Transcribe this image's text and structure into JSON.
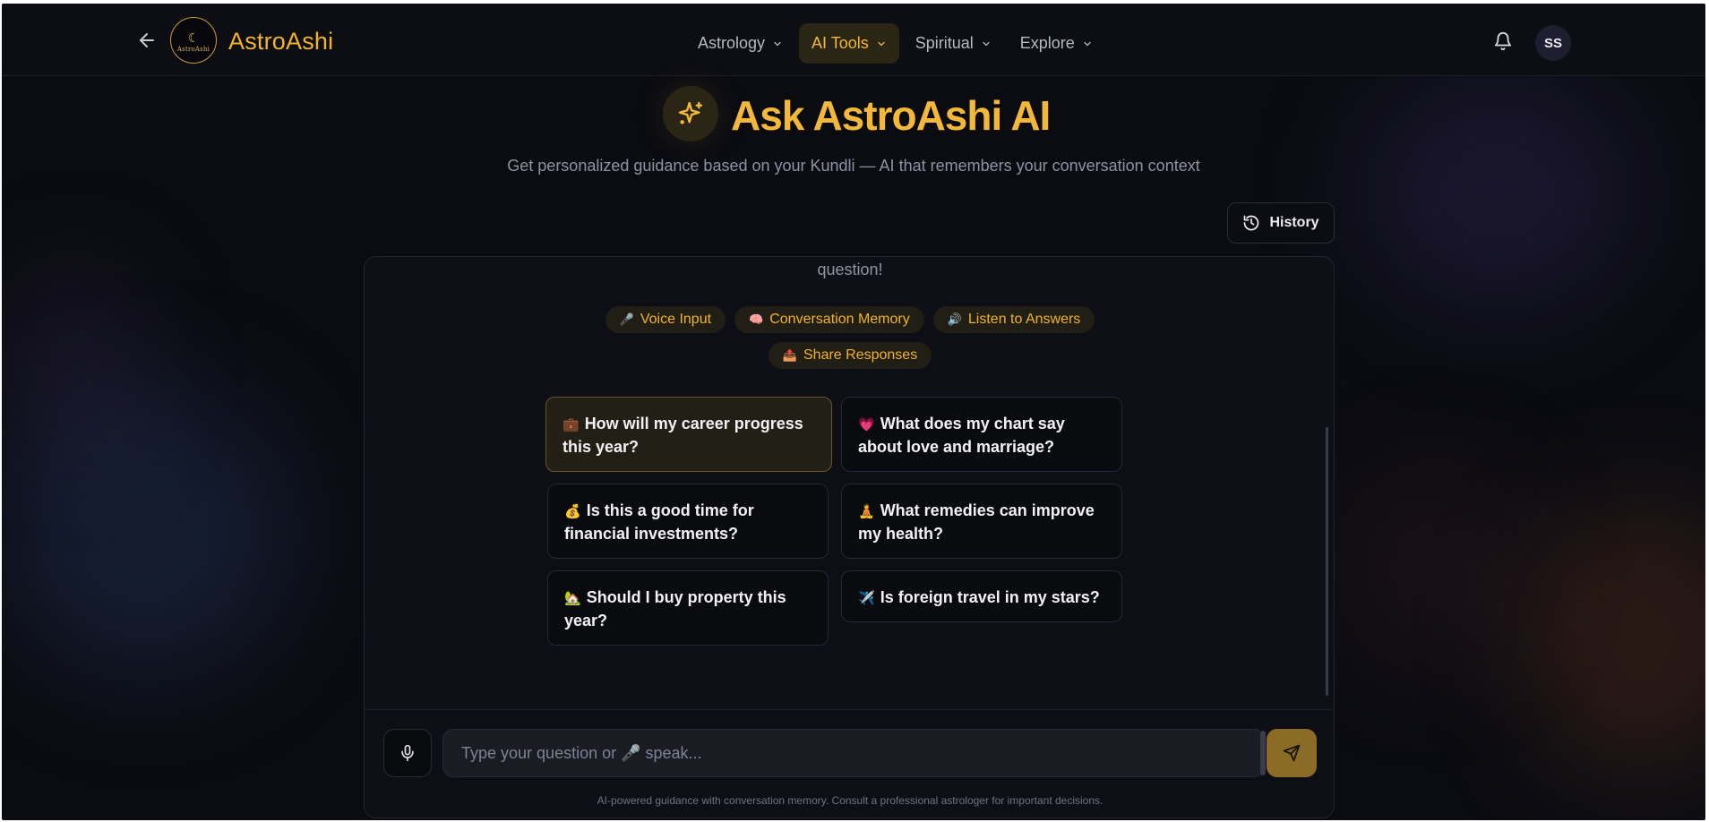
{
  "header": {
    "brand": "AstroAshi",
    "logo_text": "AstroAshi",
    "nav": [
      {
        "label": "Astrology",
        "active": false
      },
      {
        "label": "AI Tools",
        "active": true
      },
      {
        "label": "Spiritual",
        "active": false
      },
      {
        "label": "Explore",
        "active": false
      }
    ],
    "avatar_initials": "SS",
    "icons": {
      "back": "arrow-left-icon",
      "notifications": "bell-icon"
    }
  },
  "hero": {
    "icon": "sparkles-icon",
    "title": "Ask AstroAshi AI",
    "subtitle": "Get personalized guidance based on your Kundli — AI that remembers your conversation context"
  },
  "history_button": {
    "label": "History",
    "icon": "history-icon"
  },
  "chat": {
    "intro_tail": "question!",
    "features": [
      {
        "emoji": "🎤",
        "label": "Voice Input"
      },
      {
        "emoji": "🧠",
        "label": "Conversation Memory"
      },
      {
        "emoji": "🔊",
        "label": "Listen to Answers"
      },
      {
        "emoji": "📤",
        "label": "Share Responses"
      }
    ],
    "suggestions": [
      {
        "emoji": "💼",
        "text": "How will my career progress this year?",
        "active": true
      },
      {
        "emoji": "💗",
        "text": "What does my chart say about love and marriage?",
        "active": false
      },
      {
        "emoji": "💰",
        "text": "Is this a good time for financial investments?",
        "active": false
      },
      {
        "emoji": "🧘",
        "text": "What remedies can improve my health?",
        "active": false
      },
      {
        "emoji": "🏡",
        "text": "Should I buy property this year?",
        "active": false
      },
      {
        "emoji": "✈️",
        "text": "Is foreign travel in my stars?",
        "active": false
      }
    ],
    "input": {
      "placeholder": "Type your question or 🎤 speak...",
      "value": ""
    },
    "disclaimer": "AI-powered guidance with conversation memory. Consult a professional astrologer for important decisions."
  },
  "colors": {
    "accent": "#f3b83a",
    "background": "#0b0c12",
    "chip_bg": "#211e16",
    "send_button": "#8b6c26"
  }
}
